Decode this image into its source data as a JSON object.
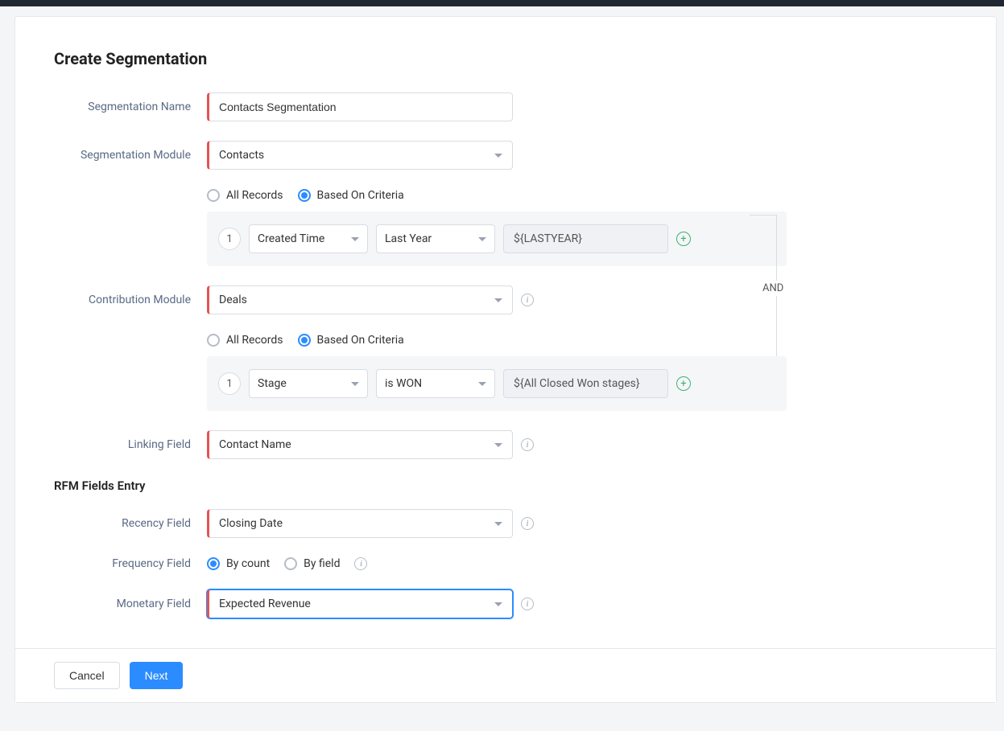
{
  "page": {
    "title": "Create Segmentation",
    "rfm_section_title": "RFM Fields Entry"
  },
  "labels": {
    "segmentation_name": "Segmentation Name",
    "segmentation_module": "Segmentation Module",
    "contribution_module": "Contribution Module",
    "linking_field": "Linking Field",
    "recency_field": "Recency Field",
    "frequency_field": "Frequency Field",
    "monetary_field": "Monetary Field"
  },
  "values": {
    "segmentation_name": "Contacts Segmentation",
    "segmentation_module": "Contacts",
    "contribution_module": "Deals",
    "linking_field": "Contact Name",
    "recency_field": "Closing Date",
    "monetary_field": "Expected Revenue"
  },
  "radios": {
    "all_records": "All Records",
    "based_on_criteria": "Based On Criteria",
    "by_count": "By count",
    "by_field": "By field"
  },
  "criteria": {
    "segmentation": {
      "row": "1",
      "field": "Created Time",
      "operator": "Last Year",
      "value": "${LASTYEAR}"
    },
    "contribution": {
      "row": "1",
      "field": "Stage",
      "operator": "is WON",
      "value": "${All Closed Won stages}"
    },
    "connector": "AND"
  },
  "buttons": {
    "cancel": "Cancel",
    "next": "Next"
  }
}
